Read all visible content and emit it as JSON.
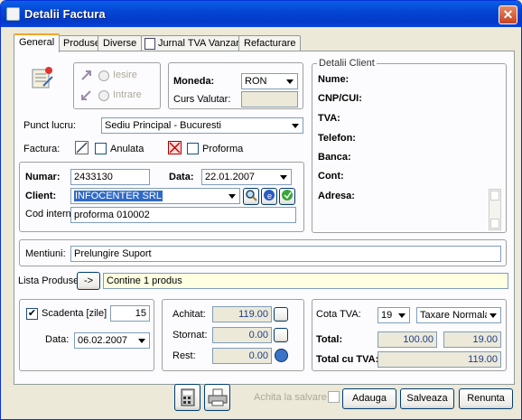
{
  "window": {
    "title": "Detalii Factura",
    "close_label": "✕"
  },
  "tabs": [
    "General",
    "Produse",
    "Diverse",
    "Jurnal TVA Vanzari",
    "Refacturare"
  ],
  "general": {
    "iesire": "Iesire",
    "intrare": "Intrare",
    "moneda_label": "Moneda:",
    "moneda_value": "RON",
    "curs_label": "Curs Valutar:",
    "curs_value": "",
    "punct_label": "Punct lucru:",
    "punct_value": "Sediu Principal - Bucuresti",
    "factura_label": "Factura:",
    "anulata_label": "Anulata",
    "proforma_label": "Proforma",
    "numar_label": "Numar:",
    "numar_value": "2433130",
    "data_label": "Data:",
    "data_value": "22.01.2007",
    "client_label": "Client:",
    "client_value": "INFOCENTER SRL",
    "cod_label": "Cod intern:",
    "cod_value": "proforma 010002"
  },
  "client_details": {
    "title": "Detalii Client",
    "nume": "Nume:",
    "cnp": "CNP/CUI:",
    "tva": "TVA:",
    "telefon": "Telefon:",
    "banca": "Banca:",
    "cont": "Cont:",
    "adresa": "Adresa:"
  },
  "mentiuni": {
    "label": "Mentiuni:",
    "value": "Prelungire Suport"
  },
  "lista": {
    "label": "Lista Produse",
    "button": "->",
    "value": "Contine 1 produs"
  },
  "scadenta": {
    "label": "Scadenta [zile]",
    "checked": "✔",
    "zile": "15",
    "data_label": "Data:",
    "data_value": "06.02.2007"
  },
  "plati": {
    "achitat_label": "Achitat:",
    "achitat": "119.00",
    "stornat_label": "Stornat:",
    "stornat": "0.00",
    "rest_label": "Rest:",
    "rest": "0.00"
  },
  "tva": {
    "cota_label": "Cota TVA:",
    "cota": "19",
    "taxare": "Taxare Normala",
    "total_label": "Total:",
    "total_net": "100.00",
    "total_tva": "19.00",
    "total_cu_tva_label": "Total cu TVA:",
    "total_cu_tva": "119.00"
  },
  "footer": {
    "achita_label": "Achita la salvare",
    "adauga": "Adauga",
    "salveaza": "Salveaza",
    "renunta": "Renunta"
  }
}
